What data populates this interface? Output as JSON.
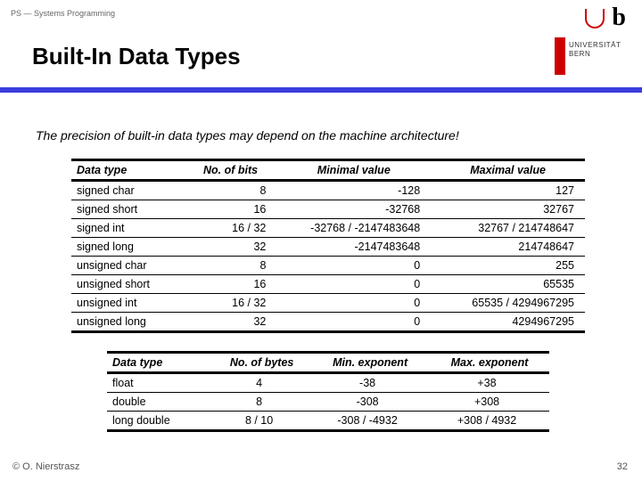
{
  "header": {
    "course": "PS — Systems Programming",
    "title": "Built-In Data Types"
  },
  "brand": {
    "line1": "UNIVERSITÄT",
    "line2": "BERN"
  },
  "intro": "The precision of built-in data types may depend on the machine architecture!",
  "table1": {
    "headers": [
      "Data type",
      "No. of bits",
      "Minimal value",
      "Maximal value"
    ],
    "rows": [
      [
        "signed char",
        "8",
        "-128",
        "127"
      ],
      [
        "signed short",
        "16",
        "-32768",
        "32767"
      ],
      [
        "signed int",
        "16 / 32",
        "-32768 / -2147483648",
        "32767 / 214748647"
      ],
      [
        "signed long",
        "32",
        "-2147483648",
        "214748647"
      ],
      [
        "unsigned char",
        "8",
        "0",
        "255"
      ],
      [
        "unsigned short",
        "16",
        "0",
        "65535"
      ],
      [
        "unsigned int",
        "16 / 32",
        "0",
        "65535 / 4294967295"
      ],
      [
        "unsigned long",
        "32",
        "0",
        "4294967295"
      ]
    ]
  },
  "table2": {
    "headers": [
      "Data type",
      "No. of bytes",
      "Min. exponent",
      "Max. exponent"
    ],
    "rows": [
      [
        "float",
        "4",
        "-38",
        "+38"
      ],
      [
        "double",
        "8",
        "-308",
        "+308"
      ],
      [
        "long double",
        "8 / 10",
        "-308 / -4932",
        "+308 / 4932"
      ]
    ]
  },
  "footer": {
    "left": "© O. Nierstrasz",
    "right": "32"
  }
}
